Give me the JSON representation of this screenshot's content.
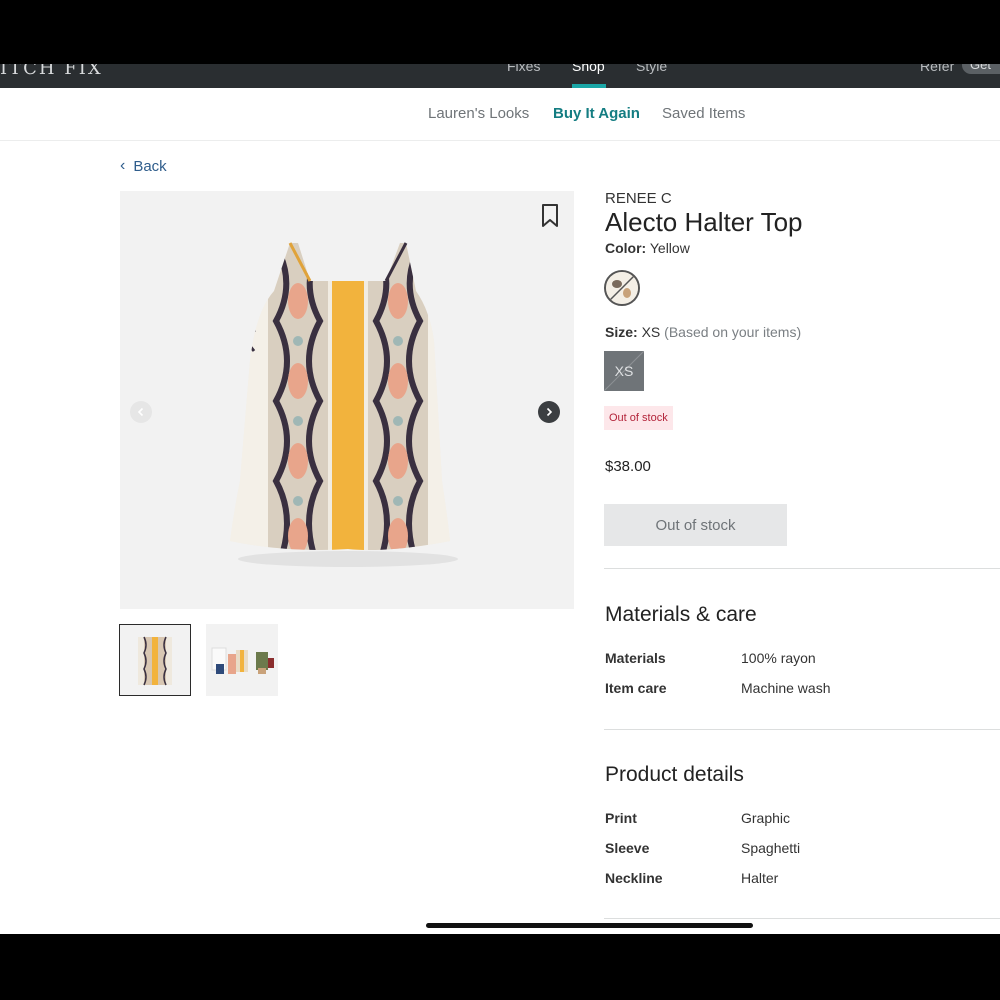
{
  "topnav": {
    "brand": "ITCH FIX",
    "links": [
      "Fixes",
      "Shop",
      "Style"
    ],
    "active_index": 1,
    "refer": "Refer",
    "pill": "Get"
  },
  "subnav": {
    "links": [
      "Lauren's Looks",
      "Buy It Again",
      "Saved Items"
    ],
    "active_index": 1
  },
  "back_label": "Back",
  "product": {
    "brand": "RENEE C",
    "title": "Alecto Halter Top",
    "color_label": "Color:",
    "color_value": "Yellow",
    "size_label": "Size:",
    "size_value": "XS",
    "size_note": "(Based on your items)",
    "size_option": "XS",
    "stock_badge": "Out of stock",
    "price": "$38.00",
    "button_label": "Out of stock"
  },
  "materials": {
    "title": "Materials & care",
    "rows": [
      {
        "label": "Materials",
        "value": "100% rayon"
      },
      {
        "label": "Item care",
        "value": "Machine wash"
      }
    ]
  },
  "details": {
    "title": "Product details",
    "rows": [
      {
        "label": "Print",
        "value": "Graphic"
      },
      {
        "label": "Sleeve",
        "value": "Spaghetti"
      },
      {
        "label": "Neckline",
        "value": "Halter"
      }
    ]
  },
  "colors": {
    "accent": "#147d82",
    "nav_bg": "#2a2e31",
    "oos_bg": "#fde7ea",
    "oos_text": "#b3243a",
    "back_link": "#2f5d8c"
  }
}
